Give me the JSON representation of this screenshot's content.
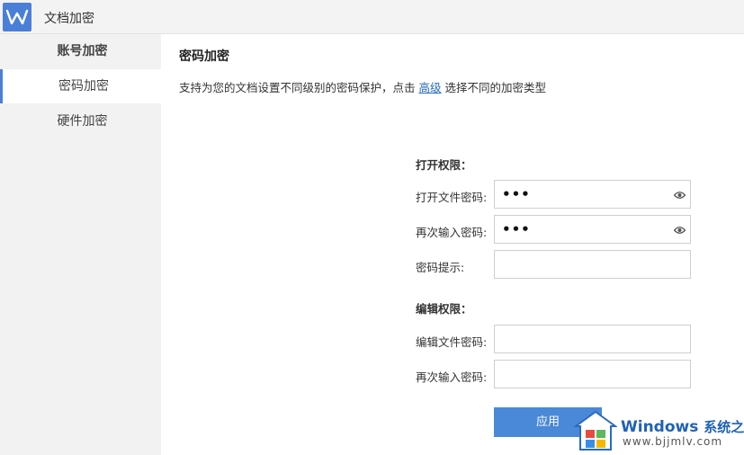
{
  "window": {
    "title": "文档加密",
    "app_icon": "wps-writer-icon",
    "accent": "#4a7fd8"
  },
  "sidebar": {
    "items": [
      {
        "label": "账号加密"
      },
      {
        "label": "密码加密",
        "active": true
      },
      {
        "label": "硬件加密"
      }
    ]
  },
  "main": {
    "title": "密码加密",
    "desc_before": "支持为您的文档设置不同级别的密码保护，点击 ",
    "desc_link": "高级",
    "desc_after": " 选择不同的加密类型",
    "open_section": "打开权限：",
    "open_pw_label": "打开文件密码:",
    "open_pw_value": "•••",
    "open_confirm_label": "再次输入密码:",
    "open_confirm_value": "•••",
    "hint_label": "密码提示:",
    "edit_section": "编辑权限：",
    "edit_pw_label": "编辑文件密码:",
    "edit_confirm_label": "再次输入密码:",
    "apply_label": "应用"
  },
  "watermark": {
    "title": "Windows",
    "title_cn": "系统之家",
    "url": "www.bjjmlv.com"
  }
}
